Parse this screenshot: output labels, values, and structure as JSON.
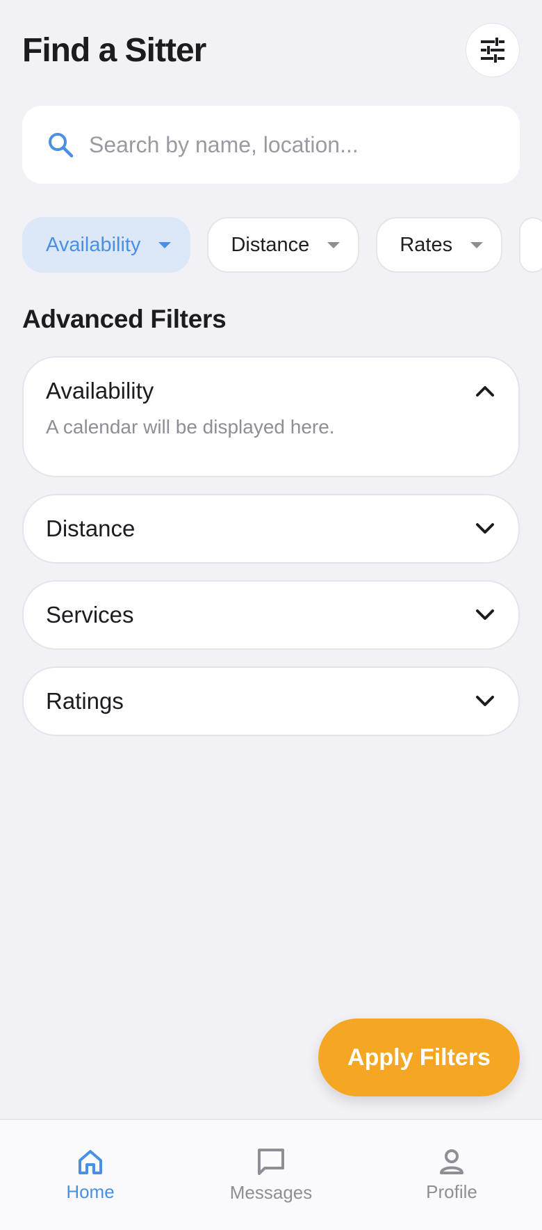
{
  "header": {
    "title": "Find a Sitter",
    "filter_icon": "sliders-icon"
  },
  "search": {
    "placeholder": "Search by name, location...",
    "value": "",
    "icon": "search-icon"
  },
  "chips": [
    {
      "label": "Availability",
      "active": true
    },
    {
      "label": "Distance",
      "active": false
    },
    {
      "label": "Rates",
      "active": false
    }
  ],
  "advanced": {
    "title": "Advanced Filters",
    "panels": [
      {
        "label": "Availability",
        "expanded": true,
        "body": "A calendar will be displayed here."
      },
      {
        "label": "Distance",
        "expanded": false
      },
      {
        "label": "Services",
        "expanded": false
      },
      {
        "label": "Ratings",
        "expanded": false
      }
    ]
  },
  "apply_button": {
    "label": "Apply Filters"
  },
  "tabbar": {
    "items": [
      {
        "label": "Home",
        "icon": "home-icon",
        "active": true
      },
      {
        "label": "Messages",
        "icon": "message-icon",
        "active": false
      },
      {
        "label": "Profile",
        "icon": "person-icon",
        "active": false
      }
    ]
  },
  "colors": {
    "accent": "#4A90E2",
    "accent_light": "#DCE8F8",
    "cta": "#F5A623",
    "background": "#F1F1F6",
    "text": "#1B1C20",
    "muted": "#8E8E96"
  }
}
